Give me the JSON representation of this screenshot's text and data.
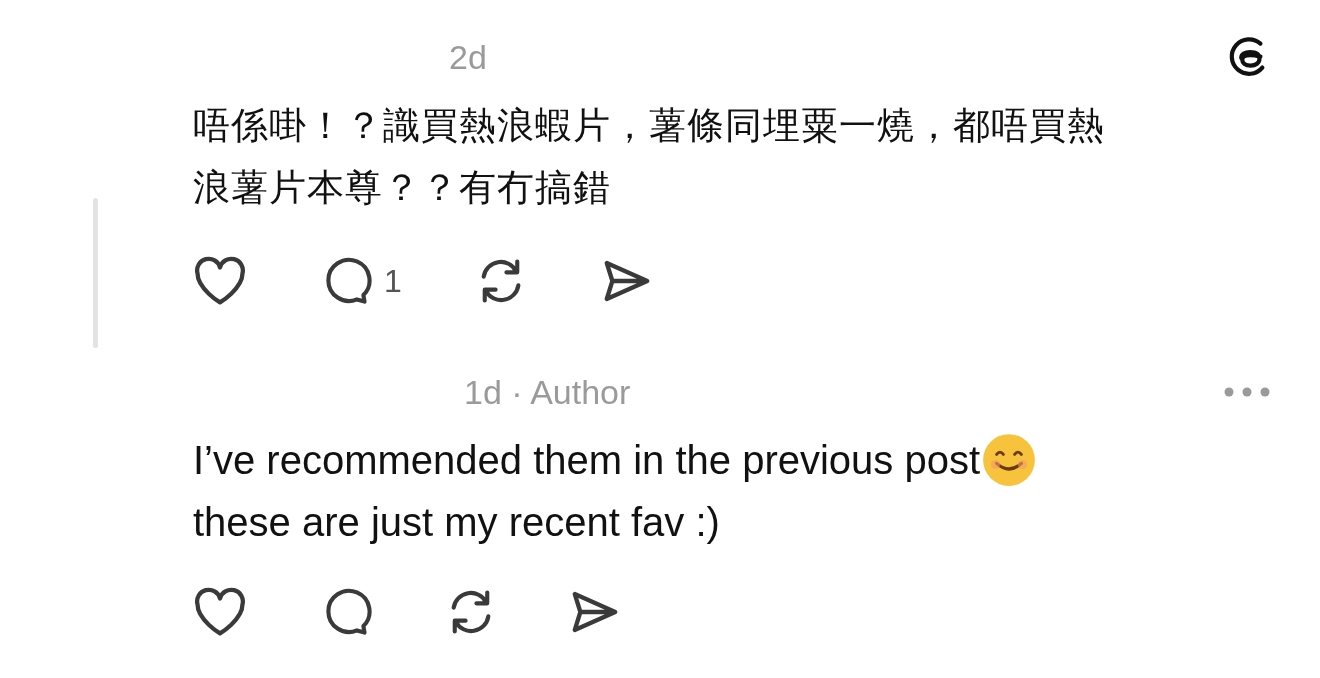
{
  "comments": [
    {
      "meta": "2d",
      "kind": "logo",
      "thread_line": true,
      "body_lines": [
        {
          "text": "唔係啩！？識買熱浪蝦片，薯條同埋粟一燒，都唔買熱",
          "emoji": false
        },
        {
          "text": "浪薯片本尊？？有冇搞錯",
          "emoji": false
        }
      ],
      "reply_count": "1"
    },
    {
      "meta": "1d · Author",
      "kind": "more",
      "thread_line": false,
      "body_lines": [
        {
          "text": "I’ve recommended them in the previous post",
          "emoji": true
        },
        {
          "text": "these are just my recent fav :)",
          "emoji": false
        }
      ]
    }
  ]
}
